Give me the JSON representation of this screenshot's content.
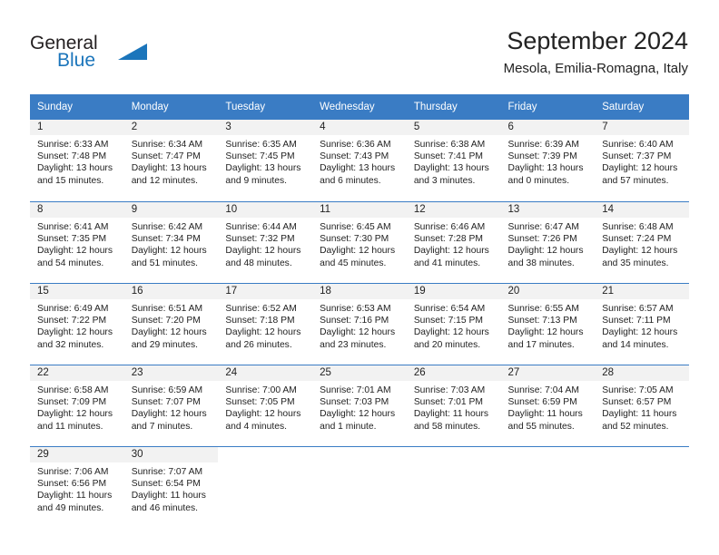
{
  "brand": {
    "name_part1": "General",
    "name_part2": "Blue",
    "triangle_icon": "triangle-icon",
    "color_dark": "#231f20",
    "color_blue": "#1b75bb"
  },
  "header": {
    "title": "September 2024",
    "subtitle": "Mesola, Emilia-Romagna, Italy"
  },
  "theme": {
    "header_row_bg": "#3a7cc4",
    "day_band_bg": "#f2f2f2",
    "separator": "#3a7cc4",
    "text": "#222222"
  },
  "weekdays": [
    "Sunday",
    "Monday",
    "Tuesday",
    "Wednesday",
    "Thursday",
    "Friday",
    "Saturday"
  ],
  "labels": {
    "sunrise_prefix": "Sunrise:",
    "sunset_prefix": "Sunset:",
    "daylight_prefix": "Daylight:"
  },
  "weeks": [
    [
      {
        "day": "1",
        "sunrise": "Sunrise: 6:33 AM",
        "sunset": "Sunset: 7:48 PM",
        "daylight": "Daylight: 13 hours and 15 minutes."
      },
      {
        "day": "2",
        "sunrise": "Sunrise: 6:34 AM",
        "sunset": "Sunset: 7:47 PM",
        "daylight": "Daylight: 13 hours and 12 minutes."
      },
      {
        "day": "3",
        "sunrise": "Sunrise: 6:35 AM",
        "sunset": "Sunset: 7:45 PM",
        "daylight": "Daylight: 13 hours and 9 minutes."
      },
      {
        "day": "4",
        "sunrise": "Sunrise: 6:36 AM",
        "sunset": "Sunset: 7:43 PM",
        "daylight": "Daylight: 13 hours and 6 minutes."
      },
      {
        "day": "5",
        "sunrise": "Sunrise: 6:38 AM",
        "sunset": "Sunset: 7:41 PM",
        "daylight": "Daylight: 13 hours and 3 minutes."
      },
      {
        "day": "6",
        "sunrise": "Sunrise: 6:39 AM",
        "sunset": "Sunset: 7:39 PM",
        "daylight": "Daylight: 13 hours and 0 minutes."
      },
      {
        "day": "7",
        "sunrise": "Sunrise: 6:40 AM",
        "sunset": "Sunset: 7:37 PM",
        "daylight": "Daylight: 12 hours and 57 minutes."
      }
    ],
    [
      {
        "day": "8",
        "sunrise": "Sunrise: 6:41 AM",
        "sunset": "Sunset: 7:35 PM",
        "daylight": "Daylight: 12 hours and 54 minutes."
      },
      {
        "day": "9",
        "sunrise": "Sunrise: 6:42 AM",
        "sunset": "Sunset: 7:34 PM",
        "daylight": "Daylight: 12 hours and 51 minutes."
      },
      {
        "day": "10",
        "sunrise": "Sunrise: 6:44 AM",
        "sunset": "Sunset: 7:32 PM",
        "daylight": "Daylight: 12 hours and 48 minutes."
      },
      {
        "day": "11",
        "sunrise": "Sunrise: 6:45 AM",
        "sunset": "Sunset: 7:30 PM",
        "daylight": "Daylight: 12 hours and 45 minutes."
      },
      {
        "day": "12",
        "sunrise": "Sunrise: 6:46 AM",
        "sunset": "Sunset: 7:28 PM",
        "daylight": "Daylight: 12 hours and 41 minutes."
      },
      {
        "day": "13",
        "sunrise": "Sunrise: 6:47 AM",
        "sunset": "Sunset: 7:26 PM",
        "daylight": "Daylight: 12 hours and 38 minutes."
      },
      {
        "day": "14",
        "sunrise": "Sunrise: 6:48 AM",
        "sunset": "Sunset: 7:24 PM",
        "daylight": "Daylight: 12 hours and 35 minutes."
      }
    ],
    [
      {
        "day": "15",
        "sunrise": "Sunrise: 6:49 AM",
        "sunset": "Sunset: 7:22 PM",
        "daylight": "Daylight: 12 hours and 32 minutes."
      },
      {
        "day": "16",
        "sunrise": "Sunrise: 6:51 AM",
        "sunset": "Sunset: 7:20 PM",
        "daylight": "Daylight: 12 hours and 29 minutes."
      },
      {
        "day": "17",
        "sunrise": "Sunrise: 6:52 AM",
        "sunset": "Sunset: 7:18 PM",
        "daylight": "Daylight: 12 hours and 26 minutes."
      },
      {
        "day": "18",
        "sunrise": "Sunrise: 6:53 AM",
        "sunset": "Sunset: 7:16 PM",
        "daylight": "Daylight: 12 hours and 23 minutes."
      },
      {
        "day": "19",
        "sunrise": "Sunrise: 6:54 AM",
        "sunset": "Sunset: 7:15 PM",
        "daylight": "Daylight: 12 hours and 20 minutes."
      },
      {
        "day": "20",
        "sunrise": "Sunrise: 6:55 AM",
        "sunset": "Sunset: 7:13 PM",
        "daylight": "Daylight: 12 hours and 17 minutes."
      },
      {
        "day": "21",
        "sunrise": "Sunrise: 6:57 AM",
        "sunset": "Sunset: 7:11 PM",
        "daylight": "Daylight: 12 hours and 14 minutes."
      }
    ],
    [
      {
        "day": "22",
        "sunrise": "Sunrise: 6:58 AM",
        "sunset": "Sunset: 7:09 PM",
        "daylight": "Daylight: 12 hours and 11 minutes."
      },
      {
        "day": "23",
        "sunrise": "Sunrise: 6:59 AM",
        "sunset": "Sunset: 7:07 PM",
        "daylight": "Daylight: 12 hours and 7 minutes."
      },
      {
        "day": "24",
        "sunrise": "Sunrise: 7:00 AM",
        "sunset": "Sunset: 7:05 PM",
        "daylight": "Daylight: 12 hours and 4 minutes."
      },
      {
        "day": "25",
        "sunrise": "Sunrise: 7:01 AM",
        "sunset": "Sunset: 7:03 PM",
        "daylight": "Daylight: 12 hours and 1 minute."
      },
      {
        "day": "26",
        "sunrise": "Sunrise: 7:03 AM",
        "sunset": "Sunset: 7:01 PM",
        "daylight": "Daylight: 11 hours and 58 minutes."
      },
      {
        "day": "27",
        "sunrise": "Sunrise: 7:04 AM",
        "sunset": "Sunset: 6:59 PM",
        "daylight": "Daylight: 11 hours and 55 minutes."
      },
      {
        "day": "28",
        "sunrise": "Sunrise: 7:05 AM",
        "sunset": "Sunset: 6:57 PM",
        "daylight": "Daylight: 11 hours and 52 minutes."
      }
    ],
    [
      {
        "day": "29",
        "sunrise": "Sunrise: 7:06 AM",
        "sunset": "Sunset: 6:56 PM",
        "daylight": "Daylight: 11 hours and 49 minutes."
      },
      {
        "day": "30",
        "sunrise": "Sunrise: 7:07 AM",
        "sunset": "Sunset: 6:54 PM",
        "daylight": "Daylight: 11 hours and 46 minutes."
      },
      {
        "day": "",
        "sunrise": "",
        "sunset": "",
        "daylight": ""
      },
      {
        "day": "",
        "sunrise": "",
        "sunset": "",
        "daylight": ""
      },
      {
        "day": "",
        "sunrise": "",
        "sunset": "",
        "daylight": ""
      },
      {
        "day": "",
        "sunrise": "",
        "sunset": "",
        "daylight": ""
      },
      {
        "day": "",
        "sunrise": "",
        "sunset": "",
        "daylight": ""
      }
    ]
  ]
}
